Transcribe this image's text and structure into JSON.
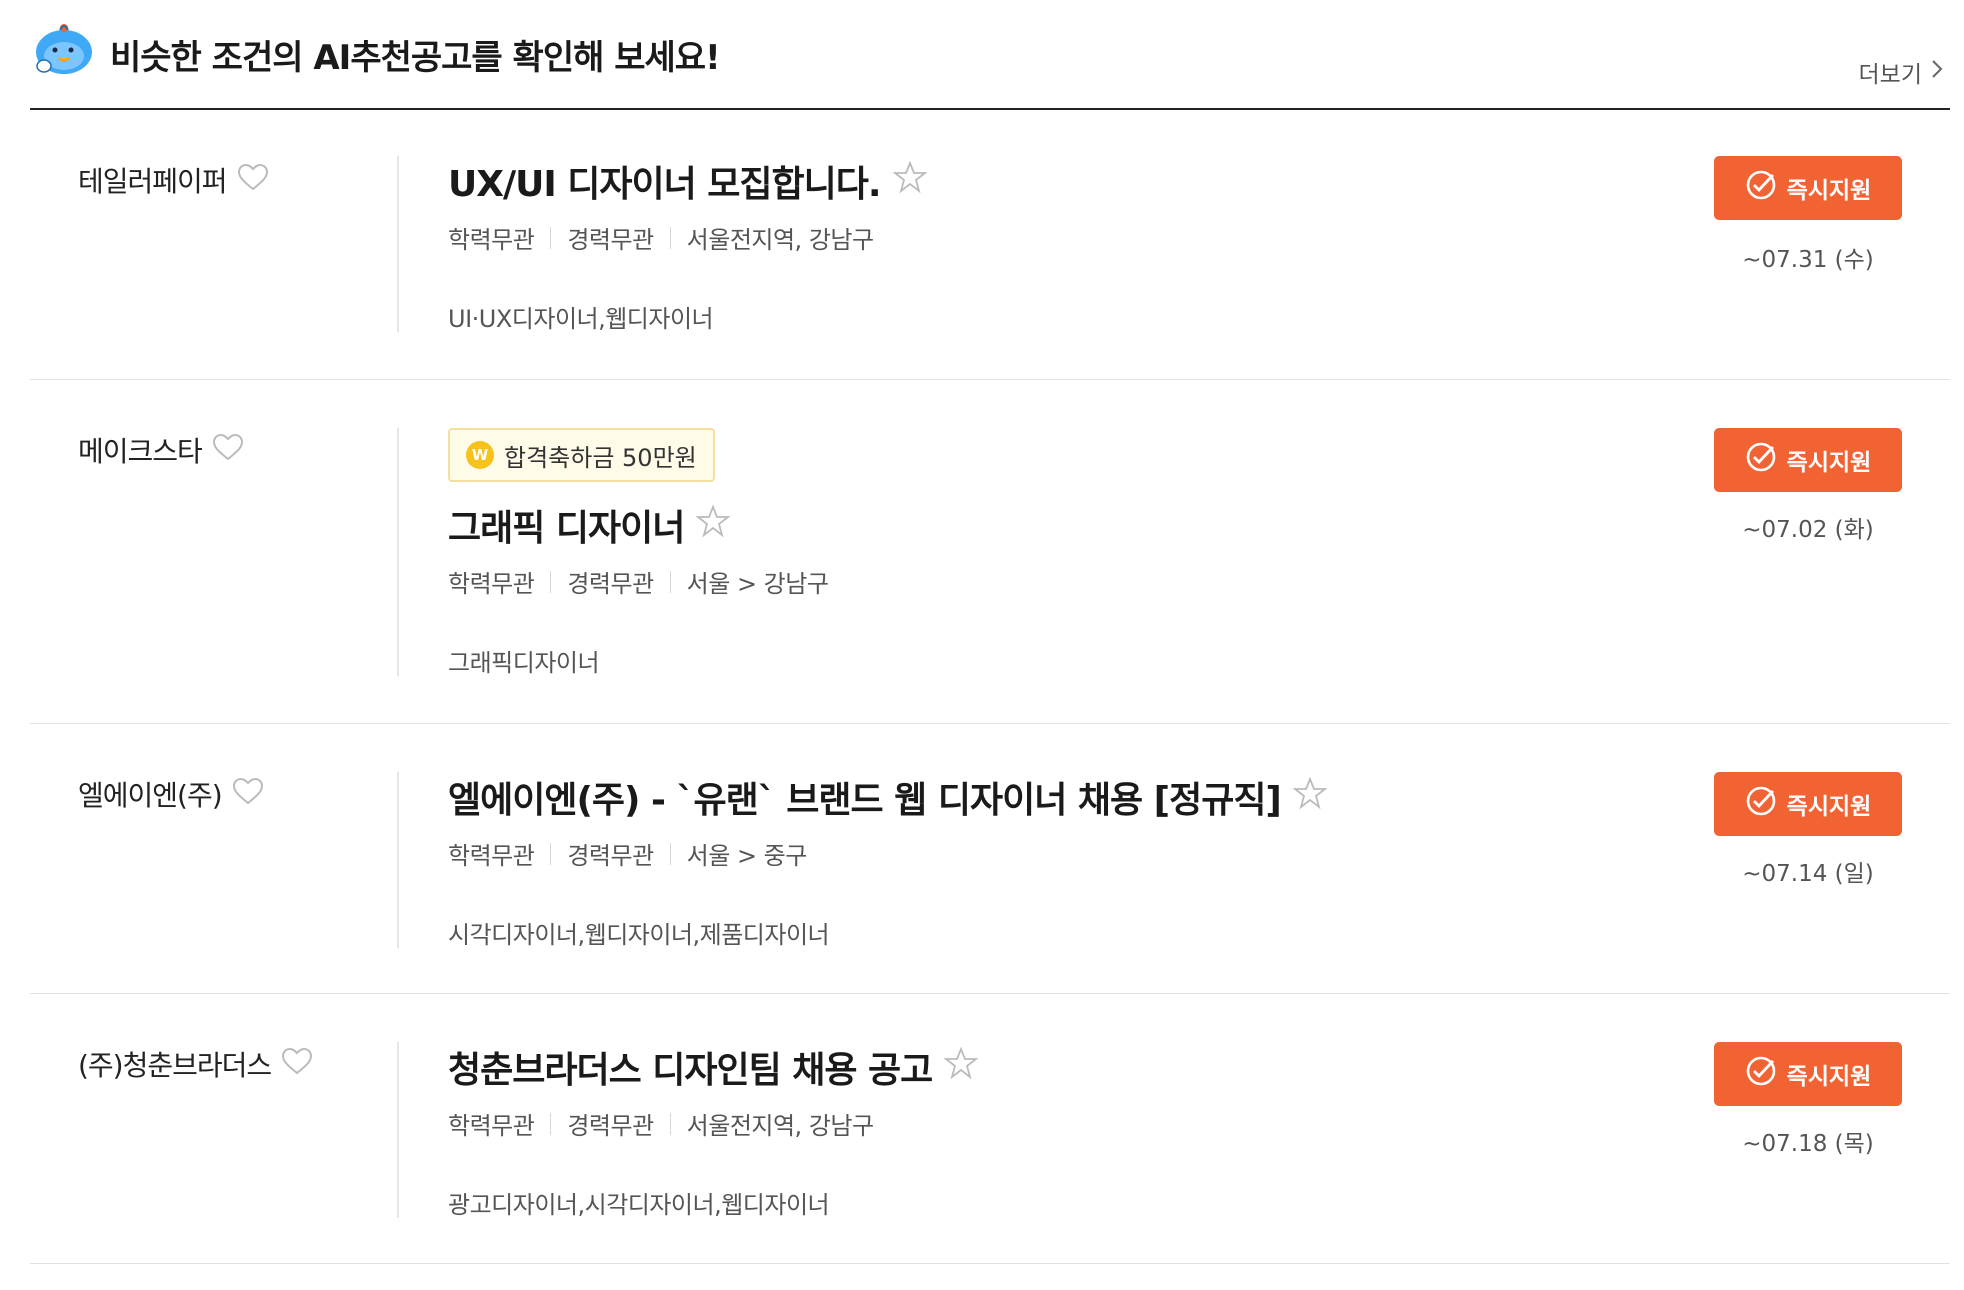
{
  "header": {
    "title": "비슷한 조건의 AI추천공고를 확인해 보세요!",
    "more_label": "더보기"
  },
  "apply_label": "즉시지원",
  "jobs": [
    {
      "company": "테일러페이퍼",
      "title": "UX/UI 디자이너 모집합니다.",
      "education": "학력무관",
      "experience": "경력무관",
      "location": "서울전지역, 강남구",
      "category": "UI·UX디자이너,웹디자이너",
      "deadline": "~07.31 (수)"
    },
    {
      "company": "메이크스타",
      "bonus": "합격축하금 50만원",
      "title": "그래픽 디자이너",
      "education": "학력무관",
      "experience": "경력무관",
      "location": "서울 > 강남구",
      "category": "그래픽디자이너",
      "deadline": "~07.02 (화)"
    },
    {
      "company": "엘에이엔(주)",
      "title": "엘에이엔(주) - `유랜` 브랜드 웹 디자이너 채용 [정규직]",
      "education": "학력무관",
      "experience": "경력무관",
      "location": "서울 > 중구",
      "category": "시각디자이너,웹디자이너,제품디자이너",
      "deadline": "~07.14 (일)"
    },
    {
      "company": "(주)청춘브라더스",
      "title": "청춘브라더스 디자인팀 채용 공고",
      "education": "학력무관",
      "experience": "경력무관",
      "location": "서울전지역, 강남구",
      "category": "광고디자이너,시각디자이너,웹디자이너",
      "deadline": "~07.18 (목)"
    }
  ],
  "colors": {
    "apply_button": "#f26333",
    "bonus_coin": "#f7c21a",
    "mascot": "#3fa9f5"
  },
  "icons": {
    "mascot": "mascot-icon",
    "favorite": "heart-icon",
    "scrap": "star-icon",
    "apply": "check-circle-icon",
    "more": "chevron-right-icon",
    "bonus": "won-coin-icon"
  }
}
